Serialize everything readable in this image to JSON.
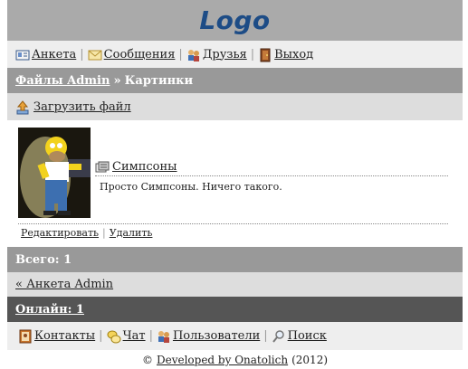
{
  "header": {
    "logo": "Logo"
  },
  "nav": {
    "items": [
      {
        "label": "Анкета",
        "icon": "profile-card-icon"
      },
      {
        "label": "Сообщения",
        "icon": "envelope-icon"
      },
      {
        "label": "Друзья",
        "icon": "friends-icon"
      },
      {
        "label": "Выход",
        "icon": "exit-door-icon"
      }
    ],
    "separator": "|"
  },
  "breadcrumb": {
    "link": "Файлы Admin",
    "separator": "»",
    "current": "Картинки"
  },
  "upload": {
    "label": "Загрузить файл",
    "icon": "upload-icon"
  },
  "file": {
    "title": "Симпсоны",
    "description": "Просто Симпсоны. Ничего такого.",
    "icon": "image-gallery-icon",
    "thumbnail_alt": "Homer Simpson picture",
    "actions": {
      "edit": "Редактировать",
      "delete": "Удалить",
      "separator": "|"
    }
  },
  "summary": {
    "total": "Всего: 1"
  },
  "back": {
    "label": "« Анкета Admin"
  },
  "online": {
    "label": "Онлайн: 1"
  },
  "bottom_nav": {
    "items": [
      {
        "label": "Контакты",
        "icon": "contacts-book-icon"
      },
      {
        "label": "Чат",
        "icon": "chat-bubbles-icon"
      },
      {
        "label": "Пользователи",
        "icon": "users-icon"
      },
      {
        "label": "Поиск",
        "icon": "search-icon"
      }
    ],
    "separator": "|"
  },
  "footer": {
    "copyright": "©",
    "link": "Developed by Onatolich",
    "year": "(2012)"
  },
  "colors": {
    "logo": "#1d4c86",
    "header_bg": "#aaaaaa",
    "nav_bg": "#eeeeee",
    "section_bg": "#999999",
    "light_bg": "#dddddd",
    "online_bg": "#555555"
  }
}
